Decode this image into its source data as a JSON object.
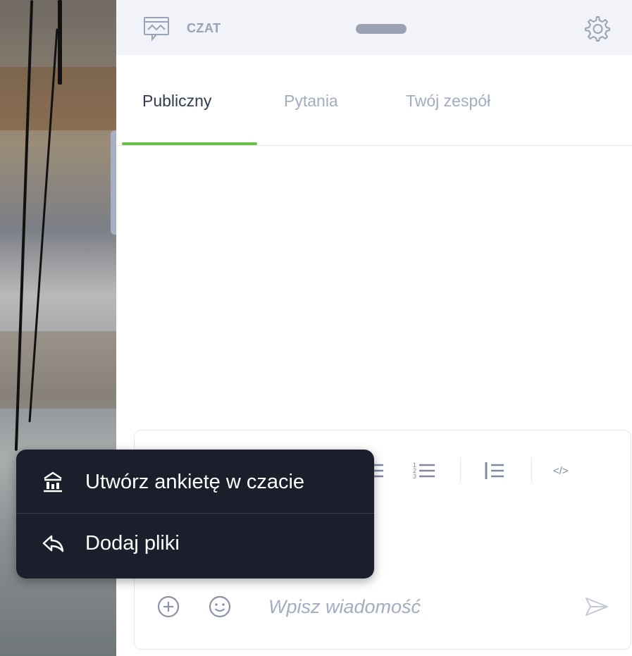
{
  "header": {
    "title": "CZAT",
    "chat_icon": "chat-window-icon",
    "settings_icon": "gear-icon"
  },
  "tabs": [
    {
      "label": "Publiczny",
      "active": true
    },
    {
      "label": "Pytania",
      "active": false
    },
    {
      "label": "Twój zespół",
      "active": false
    }
  ],
  "composer": {
    "toolbar_icons": [
      "bullet-list-icon",
      "numbered-list-icon",
      "blockquote-icon",
      "code-icon"
    ],
    "add_icon": "plus-circle-icon",
    "emoji_icon": "smiley-icon",
    "placeholder": "Wpisz wiadomość",
    "send_icon": "send-icon"
  },
  "popup_menu": {
    "items": [
      {
        "label": "Utwórz ankietę w czacie",
        "icon": "poll-icon"
      },
      {
        "label": "Dodaj pliki",
        "icon": "reply-icon"
      }
    ]
  },
  "colors": {
    "accent_tab": "#6cbf4a",
    "header_bg": "#f1f3f8",
    "popup_bg": "#1b1f2b",
    "muted_text": "#a3acbf"
  }
}
